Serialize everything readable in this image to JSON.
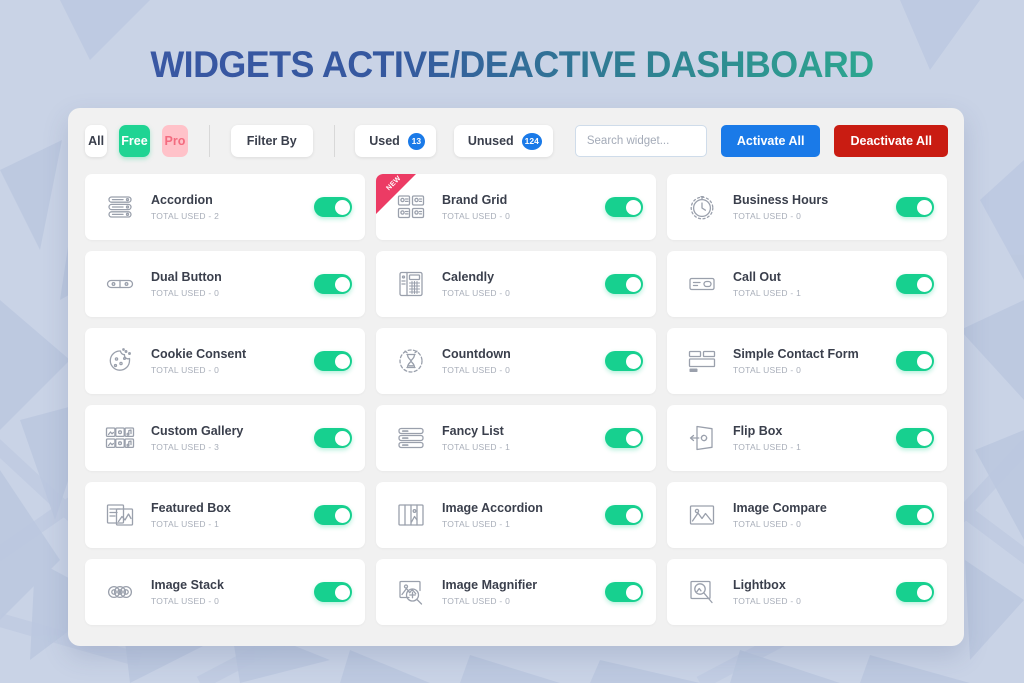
{
  "page": {
    "title": "WIDGETS ACTIVE/DEACTIVE DASHBOARD",
    "background_color": "#c9d3e6",
    "title_gradient_from": "#3b56a5",
    "title_gradient_to": "#2bbd8e"
  },
  "toolbar": {
    "all_label": "All",
    "free_label": "Free",
    "pro_label": "Pro",
    "filter_by_label": "Filter By",
    "used_label": "Used",
    "used_count": "13",
    "unused_label": "Unused",
    "unused_count": "124",
    "search_placeholder": "Search widget...",
    "search_value": "",
    "activate_all_label": "Activate All",
    "deactivate_all_label": "Deactivate All",
    "free_color": "#1fd493",
    "pro_color": "#ffc2c9",
    "badge_color": "#1a7ae8",
    "activate_color": "#1a7ae8",
    "deactivate_color": "#c91c12"
  },
  "labels": {
    "new_ribbon": "NEW",
    "total_used_prefix": "TOTAL USED - "
  },
  "widgets": [
    {
      "name": "Accordion",
      "used": "TOTAL USED - 2",
      "icon": "accordion-icon",
      "active": true,
      "is_new": false
    },
    {
      "name": "Brand Grid",
      "used": "TOTAL USED - 0",
      "icon": "brand-grid-icon",
      "active": true,
      "is_new": true
    },
    {
      "name": "Business Hours",
      "used": "TOTAL USED - 0",
      "icon": "business-hours-icon",
      "active": true,
      "is_new": false
    },
    {
      "name": "Dual Button",
      "used": "TOTAL USED - 0",
      "icon": "dual-button-icon",
      "active": true,
      "is_new": false
    },
    {
      "name": "Calendly",
      "used": "TOTAL USED - 0",
      "icon": "calendly-icon",
      "active": true,
      "is_new": false
    },
    {
      "name": "Call Out",
      "used": "TOTAL USED - 1",
      "icon": "call-out-icon",
      "active": true,
      "is_new": false
    },
    {
      "name": "Cookie Consent",
      "used": "TOTAL USED - 0",
      "icon": "cookie-consent-icon",
      "active": true,
      "is_new": false
    },
    {
      "name": "Countdown",
      "used": "TOTAL USED - 0",
      "icon": "countdown-icon",
      "active": true,
      "is_new": false
    },
    {
      "name": "Simple Contact Form",
      "used": "TOTAL USED - 0",
      "icon": "contact-form-icon",
      "active": true,
      "is_new": false
    },
    {
      "name": "Custom Gallery",
      "used": "TOTAL USED - 3",
      "icon": "custom-gallery-icon",
      "active": true,
      "is_new": false
    },
    {
      "name": "Fancy List",
      "used": "TOTAL USED - 1",
      "icon": "fancy-list-icon",
      "active": true,
      "is_new": false
    },
    {
      "name": "Flip Box",
      "used": "TOTAL USED - 1",
      "icon": "flip-box-icon",
      "active": true,
      "is_new": false
    },
    {
      "name": "Featured Box",
      "used": "TOTAL USED - 1",
      "icon": "featured-box-icon",
      "active": true,
      "is_new": false
    },
    {
      "name": "Image Accordion",
      "used": "TOTAL USED - 1",
      "icon": "image-accordion-icon",
      "active": true,
      "is_new": false
    },
    {
      "name": "Image Compare",
      "used": "TOTAL USED - 0",
      "icon": "image-compare-icon",
      "active": true,
      "is_new": false
    },
    {
      "name": "Image Stack",
      "used": "TOTAL USED - 0",
      "icon": "image-stack-icon",
      "active": true,
      "is_new": false
    },
    {
      "name": "Image Magnifier",
      "used": "TOTAL USED - 0",
      "icon": "image-magnifier-icon",
      "active": true,
      "is_new": false
    },
    {
      "name": "Lightbox",
      "used": "TOTAL USED - 0",
      "icon": "lightbox-icon",
      "active": true,
      "is_new": false
    }
  ]
}
